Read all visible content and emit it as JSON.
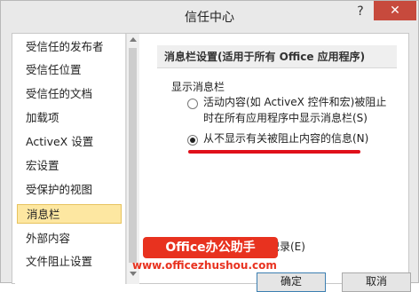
{
  "window": {
    "title": "信任中心",
    "help_label": "?",
    "close_label": "✕"
  },
  "sidebar": {
    "items": [
      {
        "label": "受信任的发布者"
      },
      {
        "label": "受信任位置"
      },
      {
        "label": "受信任的文档"
      },
      {
        "label": "加载项"
      },
      {
        "label": "ActiveX 设置"
      },
      {
        "label": "宏设置"
      },
      {
        "label": "受保护的视图"
      },
      {
        "label": "消息栏",
        "selected": true
      },
      {
        "label": "外部内容"
      },
      {
        "label": "文件阻止设置"
      }
    ]
  },
  "main": {
    "header": "消息栏设置(适用于所有 Office 应用程序)",
    "group_label": "显示消息栏",
    "option1_line1": "活动内容(如 ActiveX 控件和宏)被阻止",
    "option1_line2": "时在所有应用程序中显示消息栏(S)",
    "option2": "从不显示有关被阻止内容的信息(N)",
    "option2_checked": true,
    "record_text": "记录(E)"
  },
  "watermark": {
    "title": "Office办公助手",
    "url": "www.officezhushou.com"
  },
  "buttons": {
    "ok": "确定",
    "cancel": "取消"
  },
  "colors": {
    "selected_bg": "#fde7a1",
    "close_bg": "#c74a3d",
    "annotation_red": "#e0101a"
  }
}
